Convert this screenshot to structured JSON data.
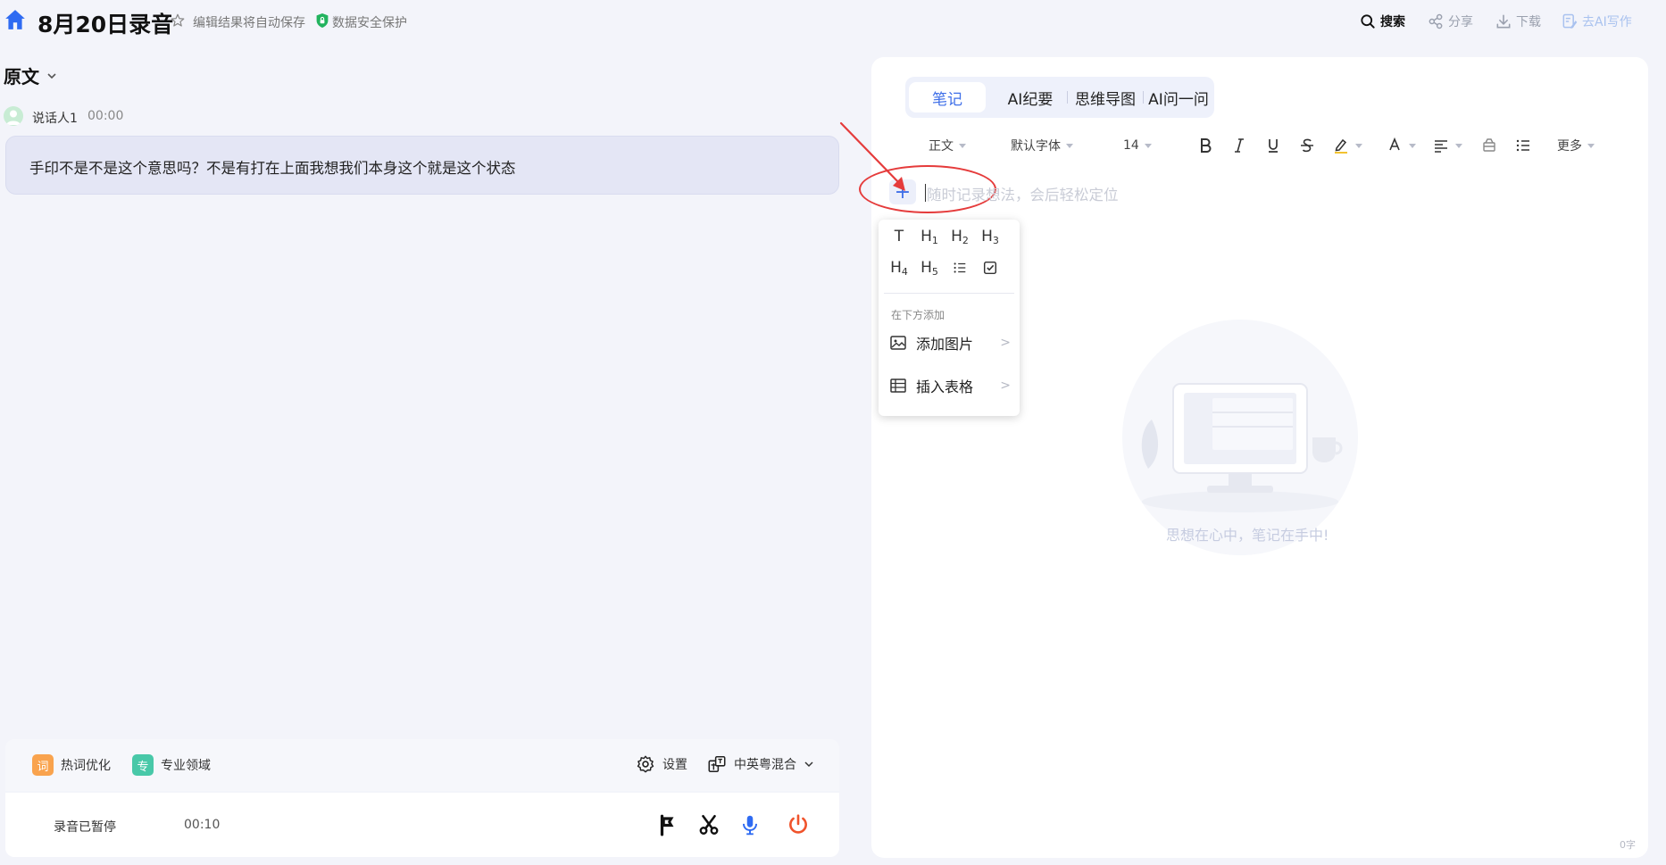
{
  "header": {
    "title": "8月20日录音",
    "autosave": "编辑结果将自动保存",
    "security": "数据安全保护",
    "search": "搜索",
    "share": "分享",
    "download": "下载",
    "ai_write": "去AI写作"
  },
  "transcript": {
    "section_label": "原文",
    "speaker": "说话人1",
    "time": "00:00",
    "text": "手印不是不是这个意思吗？不是有打在上面我想我们本身这个就是这个状态"
  },
  "options": {
    "hotwords_icon": "词",
    "hotwords": "热词优化",
    "domain_icon": "专",
    "domain": "专业领域",
    "settings": "设置",
    "language": "中英粤混合"
  },
  "recording": {
    "status": "录音已暂停",
    "elapsed": "00:10"
  },
  "notes": {
    "tabs": [
      "笔记",
      "AI纪要",
      "思维导图",
      "AI问一问"
    ],
    "active_tab": 0,
    "toolbar": {
      "style": "正文",
      "font": "默认字体",
      "size": "14",
      "more": "更多"
    },
    "placeholder": "随时记录想法，会后轻松定位",
    "empty_text": "思想在心中，笔记在手中!",
    "word_count": "0字"
  },
  "insert_menu": {
    "headings": [
      "T",
      "H1",
      "H2",
      "H3",
      "H4",
      "H5"
    ],
    "section_label": "在下方添加",
    "add_image": "添加图片",
    "insert_table": "插入表格"
  },
  "colors": {
    "accent": "#3f6fe8",
    "annotation": "#e53b3b",
    "power": "#f0532b"
  }
}
